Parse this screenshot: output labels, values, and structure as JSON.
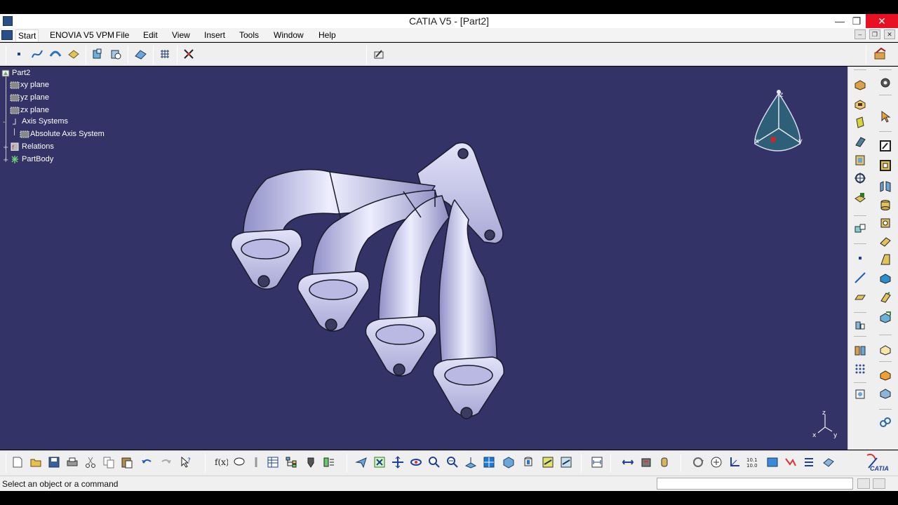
{
  "window": {
    "title": "CATIA V5 - [Part2]",
    "controls": {
      "minimize": "—",
      "maximize": "❐",
      "close": "✕"
    },
    "doc_controls": {
      "minimize": "–",
      "restore": "❐",
      "close": "✕"
    }
  },
  "menu": {
    "items": [
      "Start",
      "ENOVIA V5 VPM",
      "File",
      "Edit",
      "View",
      "Insert",
      "Tools",
      "Window",
      "Help"
    ]
  },
  "tree": {
    "root": "Part2",
    "items": [
      "xy plane",
      "yz plane",
      "zx plane",
      "Axis Systems",
      "Absolute Axis System",
      "Relations",
      "PartBody"
    ]
  },
  "compass": {
    "axis_x": "x",
    "axis_y": "y",
    "axis_z": "z"
  },
  "triad": {
    "x": "x",
    "y": "y",
    "z": "z"
  },
  "status": {
    "message": "Select an object or a command",
    "command_input": ""
  },
  "brand": {
    "logo_text": "CATIA"
  },
  "colors": {
    "viewport_bg": "#333368",
    "part": "#c9c9ef",
    "compass": "#2d5f78",
    "close_button": "#e81123"
  },
  "icons": {
    "top_toolbar": [
      "point-icon",
      "spline-icon",
      "sweep-surface-icon",
      "cut-part-icon",
      "boolean-add-icon",
      "boolean-remove-icon",
      "measure-icon",
      "grid-icon",
      "snap-icon",
      "sketch-plane-icon",
      "workbench-part-design-icon"
    ],
    "right_toolbar": [
      "pad-icon",
      "pocket-icon",
      "shaft-icon",
      "rib-icon",
      "multi-section-icon",
      "hole-icon",
      "shell-icon",
      "point-icon",
      "line-icon",
      "plane-icon",
      "axis-icon",
      "translate-icon",
      "pattern-icon",
      "constraint-icon",
      "gear-icon",
      "select-icon",
      "sketch-icon",
      "sketch-output-icon",
      "fillet-icon",
      "cylinder-icon",
      "revolve-icon",
      "thickness-icon",
      "draft-icon",
      "chamfer-icon",
      "thread-icon",
      "cube-icon",
      "cube-edit-icon",
      "cube-orange-icon",
      "cube-color-icon",
      "link-icon"
    ],
    "bottom_toolbar": [
      "new-icon",
      "open-icon",
      "save-icon",
      "print-icon",
      "cut-icon",
      "copy-icon",
      "paste-icon",
      "undo-icon",
      "redo-icon",
      "whats-this-icon",
      "formula-icon",
      "comment-icon",
      "pin-icon",
      "table-icon",
      "tree-icon",
      "thumbtack-icon",
      "analysis-icon",
      "fly-icon",
      "fit-all-icon",
      "pan-icon",
      "rotate-icon",
      "zoom-in-icon",
      "zoom-out-icon",
      "normal-view-icon",
      "view-mode-icon",
      "shading-icon",
      "hide-show-icon",
      "swap-icon",
      "properties-icon",
      "measure-between-icon",
      "measure-item-icon",
      "mass-icon",
      "update-icon",
      "mouse-icon",
      "axis-tool-icon",
      "scale-icon",
      "3d-compass-icon",
      "tolerance-icon",
      "list-icon",
      "material-icon"
    ]
  }
}
